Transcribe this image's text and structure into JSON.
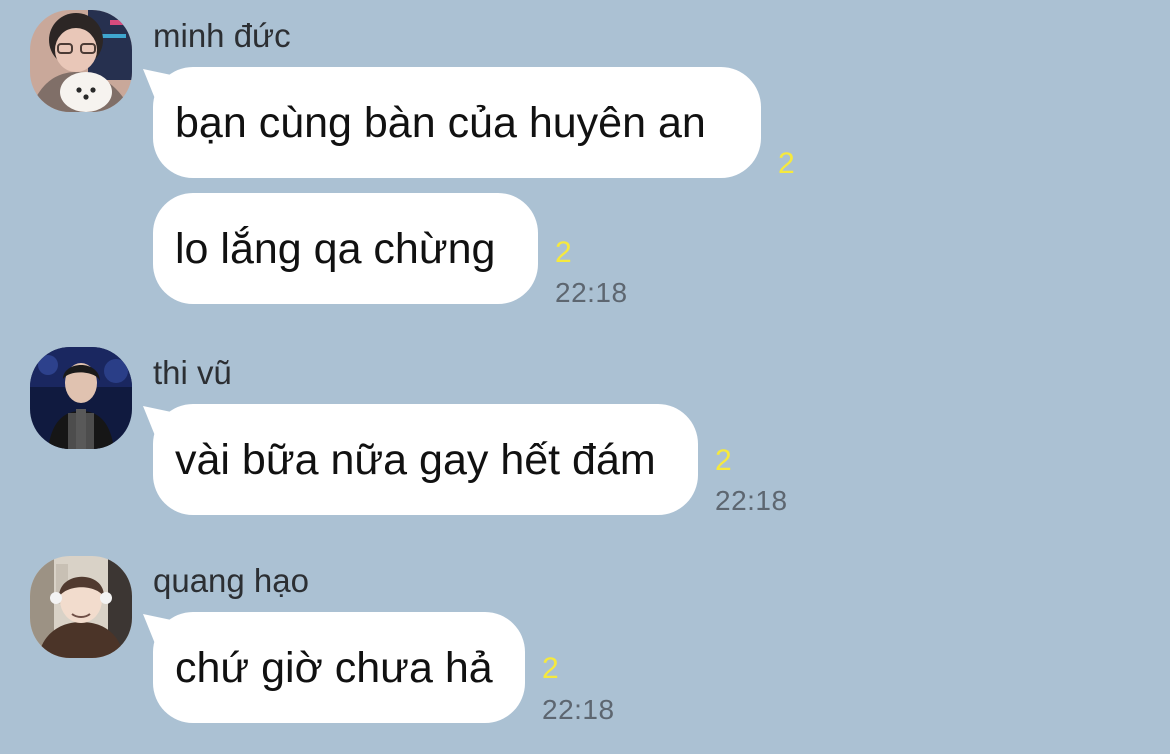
{
  "messages": [
    {
      "sender": "minh đức",
      "avatar_icon": "user-avatar-photo",
      "bubbles": [
        {
          "text": "bạn cùng bàn của huyên an",
          "unread": "2",
          "time": ""
        },
        {
          "text": "lo lắng qa chừng",
          "unread": "2",
          "time": "22:18"
        }
      ]
    },
    {
      "sender": "thi vũ",
      "avatar_icon": "user-avatar-photo",
      "bubbles": [
        {
          "text": "vài bữa nữa gay hết đám",
          "unread": "2",
          "time": "22:18"
        }
      ]
    },
    {
      "sender": "quang hạo",
      "avatar_icon": "user-avatar-photo",
      "bubbles": [
        {
          "text": "chứ giờ chưa hả",
          "unread": "2",
          "time": "22:18"
        }
      ]
    }
  ]
}
